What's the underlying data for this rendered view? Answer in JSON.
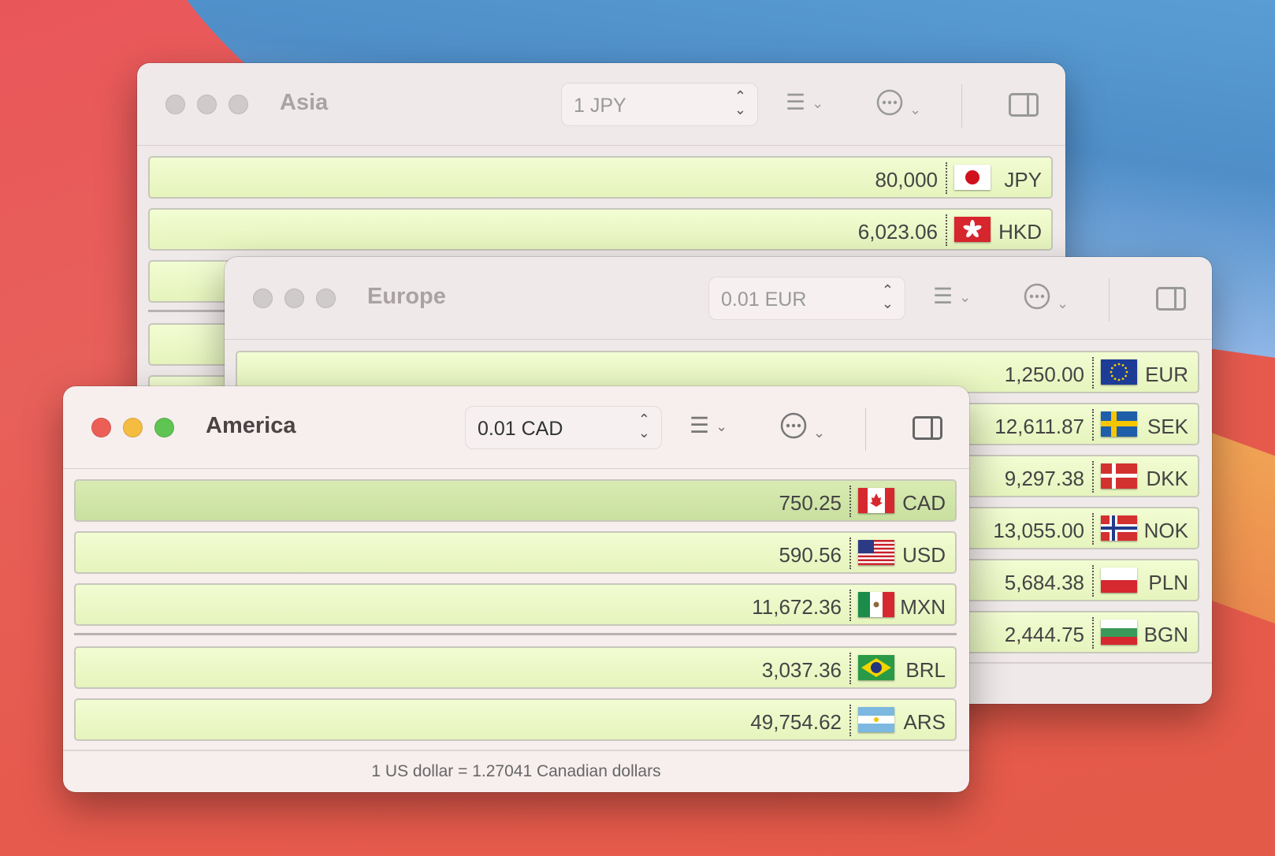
{
  "colors": {
    "row_bg": "#eaf7c4",
    "row_selected_bg": "#cfe5a8",
    "close": "#ec5f57",
    "minimize": "#f4bd41",
    "zoom": "#5fc452"
  },
  "windows": {
    "asia": {
      "title": "Asia",
      "amount": "1 JPY",
      "rows": [
        {
          "value": "80,000",
          "code": "JPY",
          "flag": "jp"
        },
        {
          "value": "6,023.06",
          "code": "HKD",
          "flag": "hk"
        },
        {
          "value": "",
          "code": "",
          "flag": ""
        },
        {
          "value": "",
          "code": "",
          "flag": ""
        },
        {
          "value": "",
          "code": "",
          "flag": ""
        }
      ]
    },
    "europe": {
      "title": "Europe",
      "amount": "0.01 EUR",
      "rows": [
        {
          "value": "1,250.00",
          "code": "EUR",
          "flag": "eu"
        },
        {
          "value": "12,611.87",
          "code": "SEK",
          "flag": "se"
        },
        {
          "value": "9,297.38",
          "code": "DKK",
          "flag": "dk"
        },
        {
          "value": "13,055.00",
          "code": "NOK",
          "flag": "no"
        },
        {
          "value": "5,684.38",
          "code": "PLN",
          "flag": "pl"
        },
        {
          "value": "2,444.75",
          "code": "BGN",
          "flag": "bg"
        }
      ]
    },
    "america": {
      "title": "America",
      "amount": "0.01 CAD",
      "rows": [
        {
          "value": "750.25",
          "code": "CAD",
          "flag": "ca",
          "selected": true
        },
        {
          "value": "590.56",
          "code": "USD",
          "flag": "us"
        },
        {
          "value": "11,672.36",
          "code": "MXN",
          "flag": "mx"
        },
        {
          "value": "3,037.36",
          "code": "BRL",
          "flag": "br"
        },
        {
          "value": "49,754.62",
          "code": "ARS",
          "flag": "ar"
        }
      ],
      "footer": "1 US dollar = 1.27041 Canadian dollars"
    }
  },
  "toolbar": {
    "list_icon": "list-icon",
    "more_icon": "ellipsis-circle-icon",
    "sidebar_icon": "sidebar-icon",
    "stepper_icon": "up-down-chevron-icon"
  }
}
